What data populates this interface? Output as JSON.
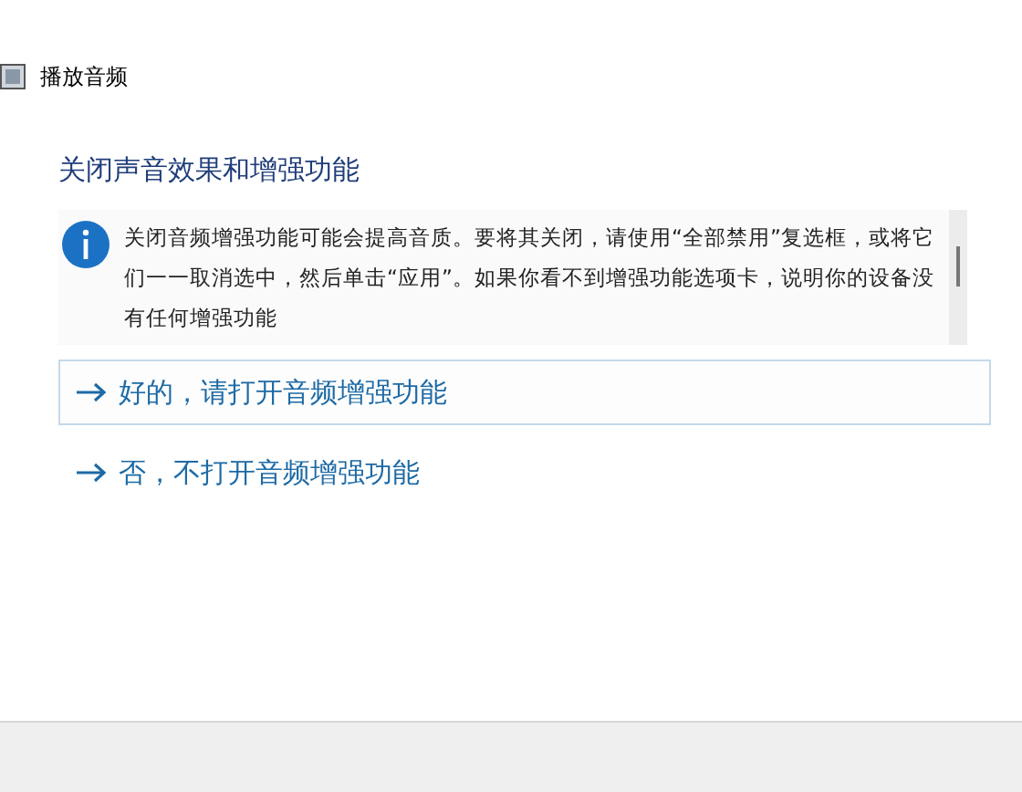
{
  "window": {
    "title": "播放音频"
  },
  "heading": "关闭声音效果和增强功能",
  "info": {
    "text": "关闭音频增强功能可能会提高音质。要将其关闭，请使用“全部禁用”复选框，或将它们一一取消选中，然后单击“应用”。如果你看不到增强功能选项卡，说明你的设备没有任何增强功能"
  },
  "options": [
    {
      "label": "好的，请打开音频增强功能",
      "selected": true
    },
    {
      "label": "否，不打开音频增强功能",
      "selected": false
    }
  ]
}
